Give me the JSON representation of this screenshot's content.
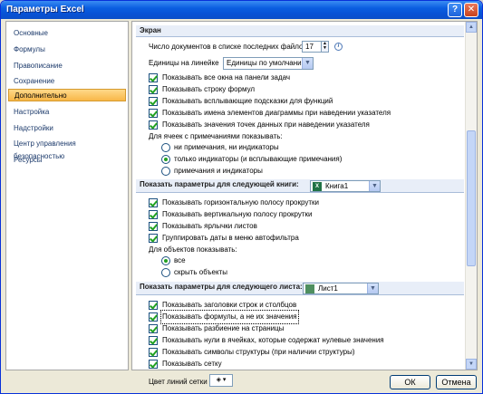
{
  "window": {
    "title": "Параметры Excel",
    "help_glyph": "?",
    "close_glyph": "✕"
  },
  "nav": {
    "items": [
      {
        "label": "Основные"
      },
      {
        "label": "Формулы"
      },
      {
        "label": "Правописание"
      },
      {
        "label": "Сохранение"
      },
      {
        "label": "Дополнительно"
      },
      {
        "label": "Настройка"
      },
      {
        "label": "Надстройки"
      },
      {
        "label": "Центр управления безопасностью"
      },
      {
        "label": "Ресурсы"
      }
    ],
    "selected": "Дополнительно"
  },
  "screen": {
    "header": "Экран",
    "recent_docs_label": "Число документов в списке последних файлов:",
    "recent_docs_value": "17",
    "ruler_units_label": "Единицы на линейке",
    "ruler_units_value": "Единицы по умолчанию",
    "checkboxes": [
      {
        "label": "Показывать все окна на панели задач",
        "checked": true
      },
      {
        "label": "Показывать строку формул",
        "checked": true
      },
      {
        "label": "Показывать всплывающие подсказки для функций",
        "checked": true
      },
      {
        "label": "Показывать имена элементов диаграммы при наведении указателя",
        "checked": true
      },
      {
        "label": "Показывать значения точек данных при наведении указателя",
        "checked": true
      }
    ],
    "comments_label": "Для ячеек с примечаниями показывать:",
    "radios": [
      {
        "label": "ни примечания, ни индикаторы",
        "selected": false
      },
      {
        "label": "только индикаторы (и всплывающие примечания)",
        "selected": true
      },
      {
        "label": "примечания и индикаторы",
        "selected": false
      }
    ]
  },
  "workbook": {
    "header": "Показать параметры для следующей книги:",
    "book_value": "Книга1",
    "book_icon": "excel-workbook-icon",
    "checkboxes": [
      {
        "label": "Показывать горизонтальную полосу прокрутки",
        "checked": true
      },
      {
        "label": "Показывать вертикальную полосу прокрутки",
        "checked": true
      },
      {
        "label": "Показывать ярлычки листов",
        "checked": true
      },
      {
        "label": "Группировать даты в меню автофильтра",
        "checked": true
      }
    ],
    "objects_label": "Для объектов показывать:",
    "radios": [
      {
        "label": "все",
        "selected": true
      },
      {
        "label": "скрыть объекты",
        "selected": false
      }
    ]
  },
  "sheet": {
    "header": "Показать параметры для следующего листа:",
    "sheet_value": "Лист1",
    "checkboxes": [
      {
        "label": "Показывать заголовки строк и столбцов",
        "checked": true
      },
      {
        "label": "Показывать формулы, а не их значения",
        "checked": true
      },
      {
        "label": "Показывать разбиение на страницы",
        "checked": true
      },
      {
        "label": "Показывать нули в ячейках, которые содержат нулевые значения",
        "checked": true
      },
      {
        "label": "Показывать символы структуры (при наличии структуры)",
        "checked": true
      },
      {
        "label": "Показывать сетку",
        "checked": true
      }
    ],
    "grid_color_label": "Цвет линий сетки",
    "grid_color_glyph": "▾"
  },
  "buttons": {
    "ok": "ОК",
    "cancel": "Отмена"
  },
  "glyphs": {
    "spin_up": "▲",
    "spin_down": "▼",
    "dropdown_arrow": "▼",
    "info": "i",
    "scroll_up": "▲",
    "scroll_down": "▼"
  },
  "colors": {
    "title_bar": "#0a5ee0",
    "selected_nav": "#f8b748",
    "checkmark": "#21a121",
    "section_header": "#e8eef8"
  }
}
